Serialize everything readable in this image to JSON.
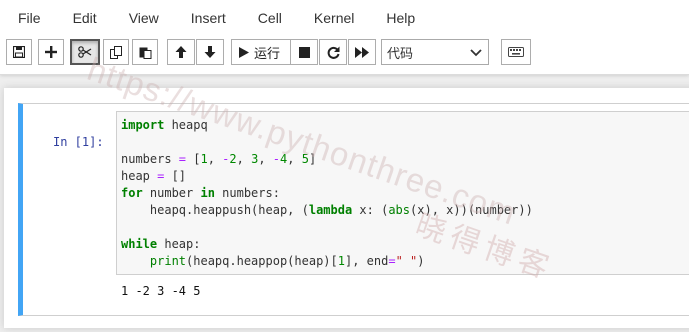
{
  "menu": [
    "File",
    "Edit",
    "View",
    "Insert",
    "Cell",
    "Kernel",
    "Help"
  ],
  "toolbar": {
    "run_label": "运行",
    "cell_type_value": "代码",
    "buttons": [
      "save-icon",
      "plus-icon",
      "cut-icon",
      "copy-icon",
      "paste-icon",
      "arrow-up-icon",
      "arrow-down-icon",
      "run-icon",
      "stop-icon",
      "restart-icon",
      "fast-forward-icon",
      "keyboard-icon"
    ]
  },
  "cell": {
    "prompt": "In  [1]:",
    "output": "1 -2 3 -4 5"
  },
  "colors": {
    "accent_border": "#42a5f5",
    "keyword": "#008000",
    "operator": "#aa22ff",
    "string": "#ba2121",
    "prompt": "#303f9f"
  },
  "watermark": {
    "url": "https://www.pythonthree.com",
    "cn": "晓得博客"
  }
}
